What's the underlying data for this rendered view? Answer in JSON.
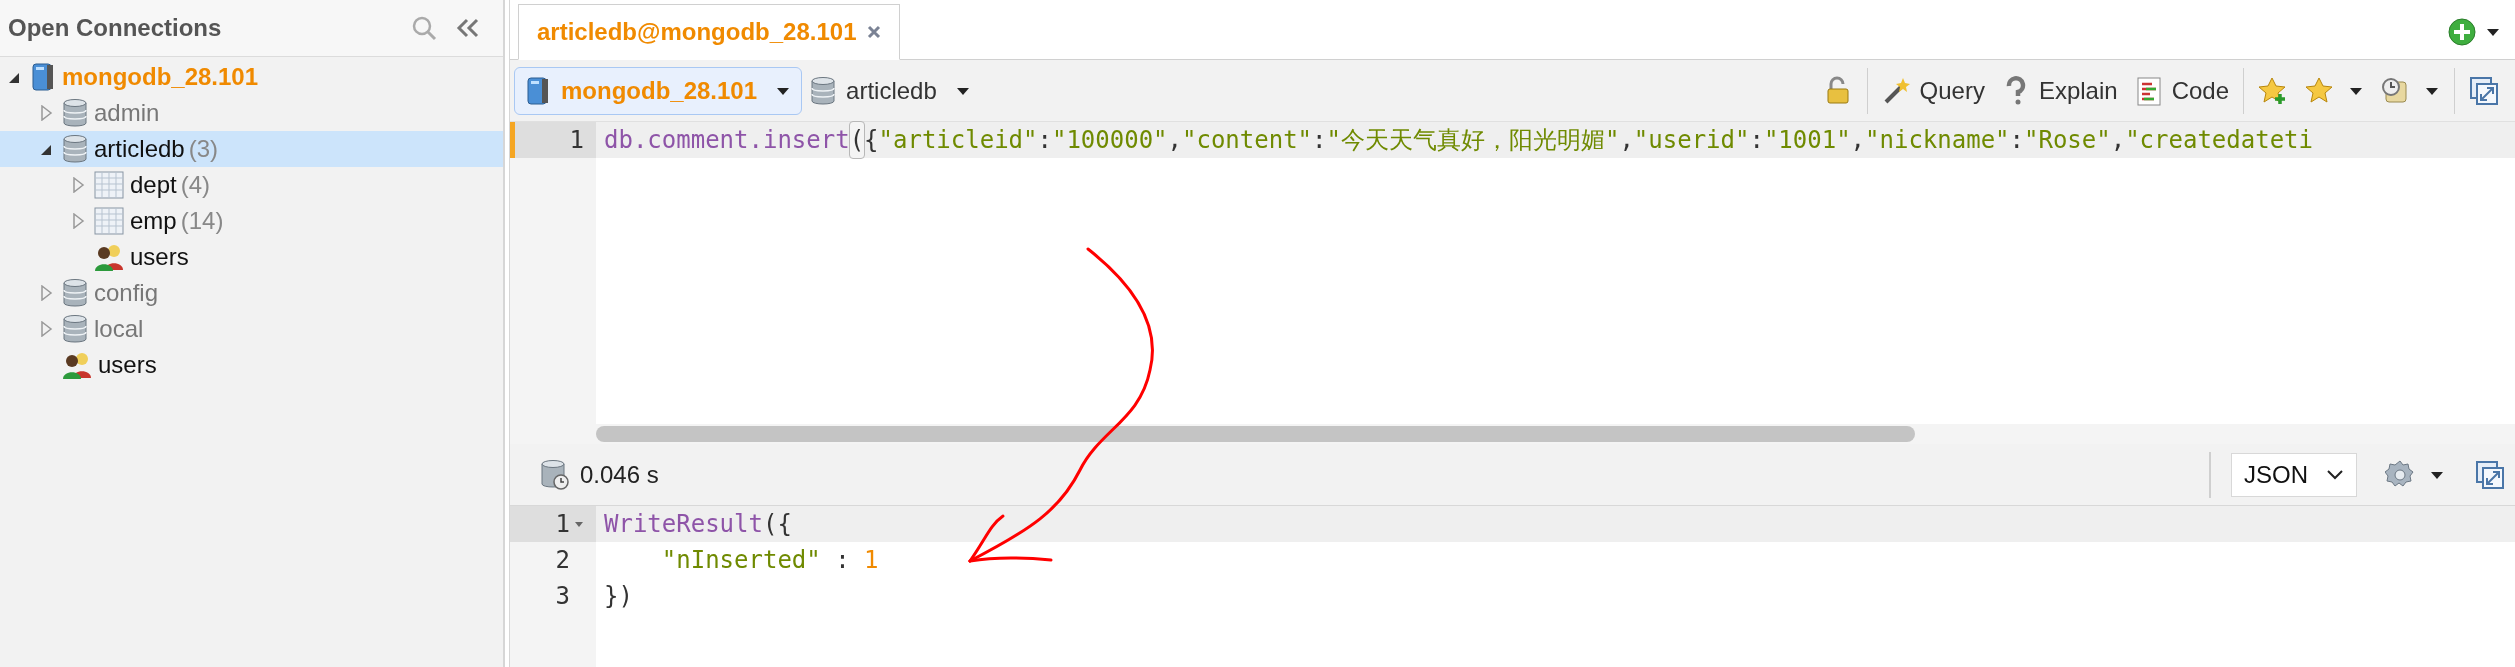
{
  "sidebar": {
    "title": "Open Connections",
    "tree": [
      {
        "kind": "server",
        "label": "mongodb_28.101",
        "expanded": true,
        "selected": false,
        "children": [
          {
            "kind": "database",
            "label": "admin",
            "expanded": false,
            "dimmed": true,
            "selected": false
          },
          {
            "kind": "database",
            "label": "articledb",
            "count": "(3)",
            "expanded": true,
            "dimmed": false,
            "selected": true,
            "children": [
              {
                "kind": "collection",
                "label": "dept",
                "count": "(4)",
                "expanded": false,
                "dimmed": false,
                "selected": false
              },
              {
                "kind": "collection",
                "label": "emp",
                "count": "(14)",
                "expanded": false,
                "dimmed": false,
                "selected": false
              },
              {
                "kind": "users",
                "label": "users",
                "dimmed": false,
                "selected": false
              }
            ]
          },
          {
            "kind": "database",
            "label": "config",
            "expanded": false,
            "dimmed": true,
            "selected": false
          },
          {
            "kind": "database",
            "label": "local",
            "expanded": false,
            "dimmed": true,
            "selected": false
          },
          {
            "kind": "users",
            "label": "users",
            "dimmed": false,
            "selected": false
          }
        ]
      }
    ]
  },
  "tabs": [
    {
      "title": "articledb@mongodb_28.101",
      "selected": true
    }
  ],
  "toolbar": {
    "connection": {
      "label": "mongodb_28.101",
      "selected": true
    },
    "database": {
      "label": "articledb"
    },
    "buttons": [
      {
        "kind": "lock"
      },
      {
        "kind": "query",
        "label": "Query"
      },
      {
        "kind": "explain",
        "label": "Explain"
      },
      {
        "kind": "code",
        "label": "Code"
      },
      {
        "kind": "star-add"
      },
      {
        "kind": "star-menu"
      },
      {
        "kind": "history-menu"
      },
      {
        "kind": "maximize"
      }
    ]
  },
  "editor": {
    "lines": [
      {
        "number": "1",
        "current": true,
        "tokens": [
          {
            "kind": "fn",
            "text": "db.comment.insert"
          },
          {
            "kind": "bracket",
            "text": "("
          },
          {
            "kind": "punct",
            "text": "{"
          },
          {
            "kind": "str",
            "text": "\"articleid\""
          },
          {
            "kind": "punct",
            "text": ":"
          },
          {
            "kind": "str",
            "text": "\"100000\""
          },
          {
            "kind": "punct",
            "text": ","
          },
          {
            "kind": "str",
            "text": "\"content\""
          },
          {
            "kind": "punct",
            "text": ":"
          },
          {
            "kind": "str",
            "text": "\"今天天气真好，阳光明媚\""
          },
          {
            "kind": "punct",
            "text": ","
          },
          {
            "kind": "str",
            "text": "\"userid\""
          },
          {
            "kind": "punct",
            "text": ":"
          },
          {
            "kind": "str",
            "text": "\"1001\""
          },
          {
            "kind": "punct",
            "text": ","
          },
          {
            "kind": "str",
            "text": "\"nickname\""
          },
          {
            "kind": "punct",
            "text": ":"
          },
          {
            "kind": "str",
            "text": "\"Rose\""
          },
          {
            "kind": "punct",
            "text": ","
          },
          {
            "kind": "str",
            "text": "\"createdateti"
          }
        ]
      }
    ]
  },
  "results": {
    "time": "0.046 s",
    "format": "JSON",
    "lines": [
      {
        "number": "1",
        "current": true,
        "fold": true,
        "tokens": [
          {
            "kind": "fn",
            "text": "WriteResult"
          },
          {
            "kind": "punct",
            "text": "({"
          }
        ]
      },
      {
        "number": "2",
        "current": false,
        "fold": false,
        "tokens": [
          {
            "kind": "str",
            "text": "    \"nInserted\""
          },
          {
            "kind": "punct",
            "text": " : "
          },
          {
            "kind": "num",
            "text": "1"
          }
        ]
      },
      {
        "number": "3",
        "current": false,
        "fold": false,
        "tokens": [
          {
            "kind": "punct",
            "text": "})"
          }
        ]
      }
    ]
  }
}
